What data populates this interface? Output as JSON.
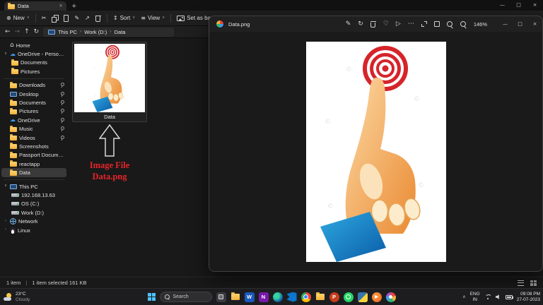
{
  "icons": {
    "home": "⌂",
    "cloud": "☁",
    "chev_r": "›",
    "chev_d": "∨",
    "chev_u": "∧",
    "back": "←",
    "forward": "→",
    "up": "↑",
    "refresh": "↻",
    "new": "⊕",
    "cut": "✂",
    "rename": "✎",
    "share": "↗",
    "sort": "↕",
    "view_menu": "≡",
    "more": "⋯",
    "edit": "✎",
    "rotate": "↻",
    "heart": "♡",
    "slideshow": "▷",
    "close": "×",
    "minimize": "—",
    "maximize": "□",
    "plus": "+",
    "tab_close": "×"
  },
  "explorer": {
    "tab": {
      "label": "Data"
    },
    "toolbar": {
      "new_label": "New",
      "sort_label": "Sort",
      "view_label": "View",
      "background_label": "Set as background"
    },
    "addressbar": {
      "path": [
        "This PC",
        "Work (D:)",
        "Data"
      ]
    },
    "sidebar": {
      "items": [
        {
          "label": "Home"
        },
        {
          "label": "OneDrive - Personal"
        },
        {
          "label": "Documents"
        },
        {
          "label": "Pictures"
        },
        {
          "label": "Downloads"
        },
        {
          "label": "Desktop"
        },
        {
          "label": "Documents"
        },
        {
          "label": "Pictures"
        },
        {
          "label": "OneDrive"
        },
        {
          "label": "Music"
        },
        {
          "label": "Videos"
        },
        {
          "label": "Screenshots"
        },
        {
          "label": "Passport Documents"
        },
        {
          "label": "reactapp"
        },
        {
          "label": "Data"
        },
        {
          "label": "This PC"
        },
        {
          "label": "192.168.13.63"
        },
        {
          "label": "OS (C:)"
        },
        {
          "label": "Work (D:)"
        },
        {
          "label": "Network"
        },
        {
          "label": "Linux"
        }
      ]
    },
    "file": {
      "label": "Data"
    },
    "annotation": {
      "line1": "Image File",
      "line2": "Data.png"
    },
    "statusbar": {
      "count": "1 item",
      "divider": "|",
      "selection": "1 item selected 161 KB"
    }
  },
  "photos": {
    "title": "Data.png",
    "zoom_level": "146%"
  },
  "taskbar": {
    "weather": {
      "temp": "23°C",
      "condition": "Cloudy"
    },
    "search_label": "Search",
    "tray": {
      "lang_top": "ENG",
      "lang_bottom": "IN",
      "time": "09:08 PM",
      "date": "27-07-2023"
    }
  }
}
